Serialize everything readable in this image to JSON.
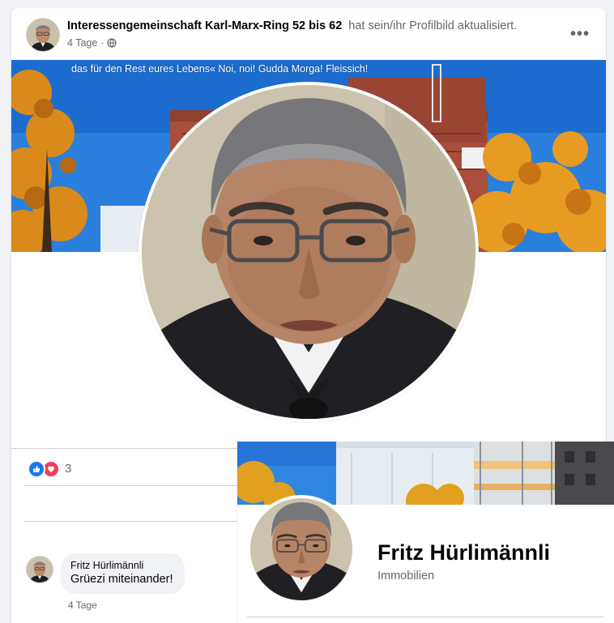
{
  "post": {
    "author": "Interessengemeinschaft Karl-Marx-Ring 52 bis 62",
    "action": "hat sein/ihr Profilbild aktualisiert.",
    "time": "4 Tage",
    "separator": "·",
    "privacy_icon": "globe-icon",
    "more_icon": "more-icon",
    "more_label": "•••",
    "cover_caption": "das für den Rest eures Lebens« Noi, noi! Gudda Morga! Fleissich!",
    "reaction_icons": [
      "like-icon",
      "love-icon"
    ],
    "reaction_count": "3"
  },
  "comment": {
    "author": "Fritz Hürlimännli",
    "text": "Grüezi miteinander!",
    "time": "4 Tage"
  },
  "profile_panel": {
    "name": "Fritz Hürlimännli",
    "subtitle": "Immobilien"
  },
  "colors": {
    "brand_blue": "#1877f2",
    "love_red": "#f33e58",
    "secondary_text": "#65676b",
    "sky_blue": "#2a82e0",
    "autumn_orange": "#e8901e"
  }
}
